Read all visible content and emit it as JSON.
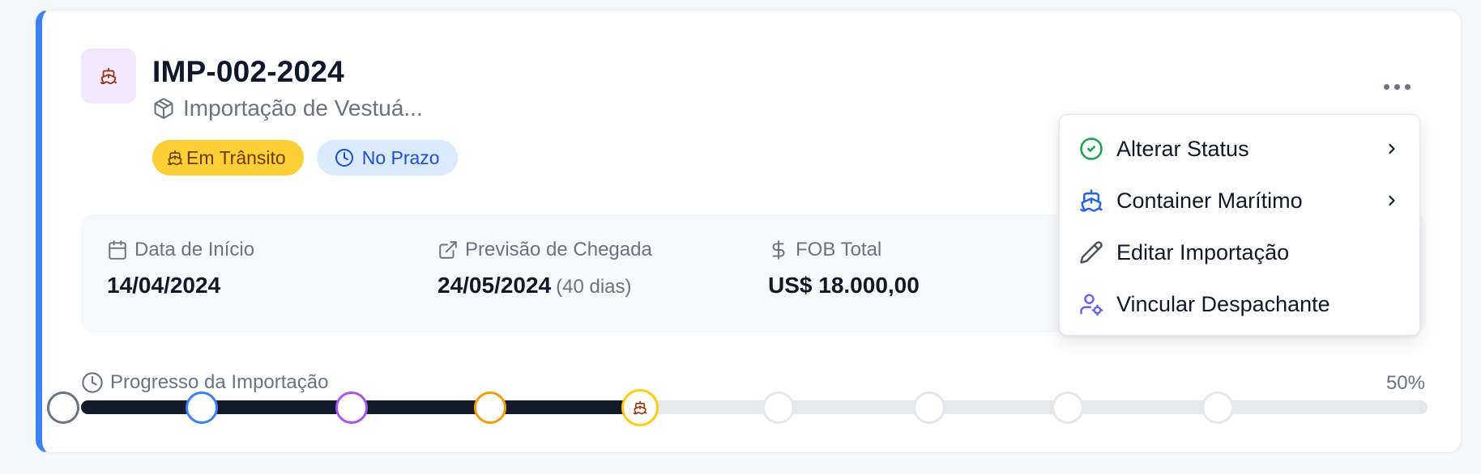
{
  "import": {
    "code": "IMP-002-2024",
    "description": "Importação de Vestuá...",
    "badges": {
      "status": "Em Trânsito",
      "deadline": "No Prazo"
    }
  },
  "info": {
    "start": {
      "label": "Data de Início",
      "value": "14/04/2024"
    },
    "eta": {
      "label": "Previsão de Chegada",
      "value": "24/05/2024",
      "extra": "(40 dias)"
    },
    "fob": {
      "label": "FOB Total",
      "value": "US$ 18.000,00"
    }
  },
  "progress": {
    "label": "Progresso da Importação",
    "percent_text": "50%",
    "percent": 50,
    "steps": [
      {
        "color": "#6b7280",
        "state": "done"
      },
      {
        "color": "#3b82f6",
        "state": "done"
      },
      {
        "color": "#a855f7",
        "state": "done"
      },
      {
        "color": "#f59e0b",
        "state": "done"
      },
      {
        "color": "#facc15",
        "state": "current",
        "icon": "ship-icon"
      },
      {
        "color": "#e5e7eb",
        "state": "pending"
      },
      {
        "color": "#e5e7eb",
        "state": "pending"
      },
      {
        "color": "#e5e7eb",
        "state": "pending"
      },
      {
        "color": "#e5e7eb",
        "state": "pending"
      }
    ]
  },
  "menu": {
    "items": [
      {
        "label": "Alterar Status",
        "icon": "check-circle-icon",
        "icon_color": "#16a34a",
        "submenu": true
      },
      {
        "label": "Container Marítimo",
        "icon": "ship-icon",
        "icon_color": "#2563eb",
        "submenu": true
      },
      {
        "label": "Editar Importação",
        "icon": "pencil-icon",
        "icon_color": "#4b5563",
        "submenu": false
      },
      {
        "label": "Vincular Despachante",
        "icon": "user-cog-icon",
        "icon_color": "#6366f1",
        "submenu": false
      }
    ]
  },
  "colors": {
    "accent": "#3b82f6",
    "status_badge": "#fcd034",
    "deadline_badge": "#dbeafe",
    "progress_fill": "#131a2a"
  }
}
